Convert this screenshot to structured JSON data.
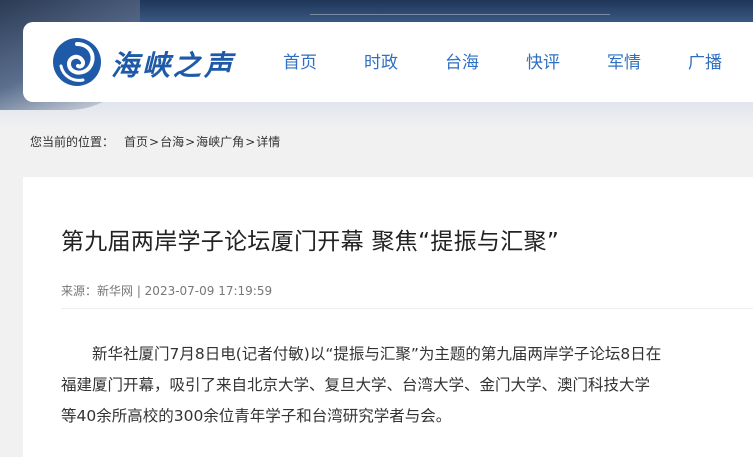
{
  "site": {
    "name": "海峡之声",
    "logo_icon": "swirl-logo-icon",
    "brand_color": "#1e5aa8"
  },
  "nav": {
    "items": [
      "首页",
      "时政",
      "台海",
      "快评",
      "军情",
      "广播"
    ],
    "color": "#2f6fc2"
  },
  "breadcrumb": {
    "prefix": "您当前的位置：",
    "items": [
      "首页",
      "台海",
      "海峡广角",
      "详情"
    ],
    "separator": ">"
  },
  "article": {
    "title": "第九届两岸学子论坛厦门开幕 聚焦“提振与汇聚”",
    "meta": "来源：新华网 | 2023-07-09 17:19:59",
    "body_lines": [
      "　　新华社厦门7月8日电(记者付敏)以“提振与汇聚”为主题的第九届两岸学子论坛8日在",
      "福建厦门开幕，吸引了来自北京大学、复旦大学、台湾大学、金门大学、澳门科技大学",
      "等40余所高校的300余位青年学子和台湾研究学者与会。"
    ]
  }
}
